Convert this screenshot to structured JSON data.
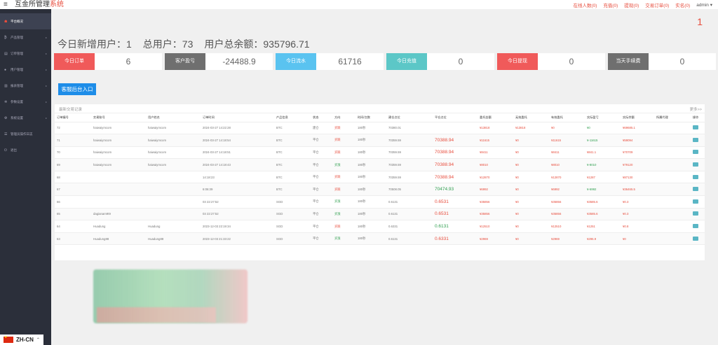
{
  "header": {
    "title_main": "互金所管理",
    "title_accent": "系统",
    "nav": [
      "在线人数(0)",
      "充值(0)",
      "提现(0)",
      "交易订单(0)",
      "实名(0)"
    ],
    "user": "admin"
  },
  "sidebar": {
    "items": [
      {
        "label": "平台概况",
        "icon": "home-icon"
      },
      {
        "label": "产品管理",
        "icon": "bitcoin-icon"
      },
      {
        "label": "订单管理",
        "icon": "list-icon"
      },
      {
        "label": "用户管理",
        "icon": "user-icon"
      },
      {
        "label": "报表管理",
        "icon": "chart-icon"
      },
      {
        "label": "参数设置",
        "icon": "gear-icon"
      },
      {
        "label": "系统设置",
        "icon": "settings-icon"
      },
      {
        "label": "管理员操作日志",
        "icon": "log-icon"
      },
      {
        "label": "退出",
        "icon": "logout-icon"
      }
    ],
    "language": "ZH-CN"
  },
  "main": {
    "corner_count": "1",
    "summary": {
      "new_users": "今日新增用户：1",
      "total_users": "总用户：73",
      "total_balance": "用户总余额：935796.71"
    },
    "stats": [
      {
        "label": "今日订单",
        "value": "6",
        "color": "#f05a5a"
      },
      {
        "label": "客户盈亏",
        "value": "-24488.9",
        "color": "#6f6f6f"
      },
      {
        "label": "今日流水",
        "value": "61716",
        "color": "#5ac3f0"
      },
      {
        "label": "今日充值",
        "value": "0",
        "color": "#5cc7c7"
      },
      {
        "label": "今日提现",
        "value": "0",
        "color": "#f05a5a"
      },
      {
        "label": "当天手续费",
        "value": "0",
        "color": "#6f6f6f"
      }
    ],
    "cs_button": "客服后台入口",
    "table": {
      "title": "最新交易记录",
      "more": "更多>>",
      "columns": [
        "订单编号",
        "交易账号",
        "用户姓名",
        "订单时间",
        "产品信息",
        "状态",
        "方向",
        "时间/点数",
        "建仓点位",
        "平仓点位",
        "委托金额",
        "无效委托",
        "有效委托",
        "实际盈亏",
        "实际余额",
        "所属代理",
        "操作"
      ],
      "rows": [
        [
          "72",
          "haiwaiymcom",
          "haiwaiymcom",
          "2024-03-27 14:22:28",
          "BTC",
          "建仓",
          "买跌",
          "180秒",
          "70380.01",
          "",
          "¥13818",
          "¥13818",
          "¥0",
          "¥0",
          "¥69685.1",
          ""
        ],
        [
          "71",
          "haiwaiymcom",
          "haiwaiymcom",
          "2024-03-27 14:18:54",
          "BTC",
          "平仓",
          "买跌",
          "180秒",
          "70359.59",
          "70388.94",
          "¥11615",
          "¥0",
          "¥11615",
          "¥-11615",
          "¥59094",
          ""
        ],
        [
          "70",
          "haiwaiymcom",
          "haiwaiymcom",
          "2024-03-27 14:18:51",
          "BTC",
          "平仓",
          "买跌",
          "180秒",
          "70359.59",
          "70388.94",
          "¥8411",
          "¥0",
          "¥8411",
          "¥841.1",
          "¥70709",
          ""
        ],
        [
          "69",
          "haiwaiymcom",
          "haiwaiymcom",
          "2024-03-27 14:18:43",
          "BTC",
          "平仓",
          "买涨",
          "180秒",
          "70359.59",
          "70388.94",
          "¥8010",
          "¥0",
          "¥8010",
          "¥-8010",
          "¥79120",
          ""
        ],
        [
          "68",
          "",
          "",
          "14:18:23",
          "BTC",
          "平仓",
          "买跌",
          "180秒",
          "70359.59",
          "70388.94",
          "¥12870",
          "¥0",
          "¥12870",
          "¥1287",
          "¥87130",
          ""
        ],
        [
          "67",
          "",
          "",
          "6:06:39",
          "BTC",
          "平仓",
          "买跌",
          "180秒",
          "70508.05",
          "70474.93",
          "¥6992",
          "¥0",
          "¥6992",
          "¥-6992",
          "¥36465.5",
          ""
        ],
        [
          "66",
          "",
          "",
          "03 22:27:52",
          "SGD",
          "平仓",
          "买涨",
          "180秒",
          "0.6131",
          "0.6531",
          "¥35856",
          "¥0",
          "¥35856",
          "¥3585.6",
          "¥0.3",
          ""
        ],
        [
          "65",
          "dagianam9t9",
          "",
          "03 22:27:52",
          "SGD",
          "平仓",
          "买涨",
          "180秒",
          "0.6131",
          "0.6531",
          "¥35856",
          "¥0",
          "¥35856",
          "¥3585.6",
          "¥0.3",
          ""
        ],
        [
          "64",
          "Huadung",
          "Huadung",
          "2023-12-03 22:19:34",
          "SGD",
          "平仓",
          "买跌",
          "180秒",
          "0.6331",
          "0.6131",
          "¥12510",
          "¥0",
          "¥12510",
          "¥1251",
          "¥0.8",
          ""
        ],
        [
          "63",
          "Huadung88",
          "Huadung88",
          "2023-12-03 21:33:22",
          "SGD",
          "平仓",
          "买涨",
          "180秒",
          "0.6131",
          "0.6331",
          "¥2969",
          "¥0",
          "¥2969",
          "¥296.9",
          "¥0",
          ""
        ]
      ]
    }
  }
}
